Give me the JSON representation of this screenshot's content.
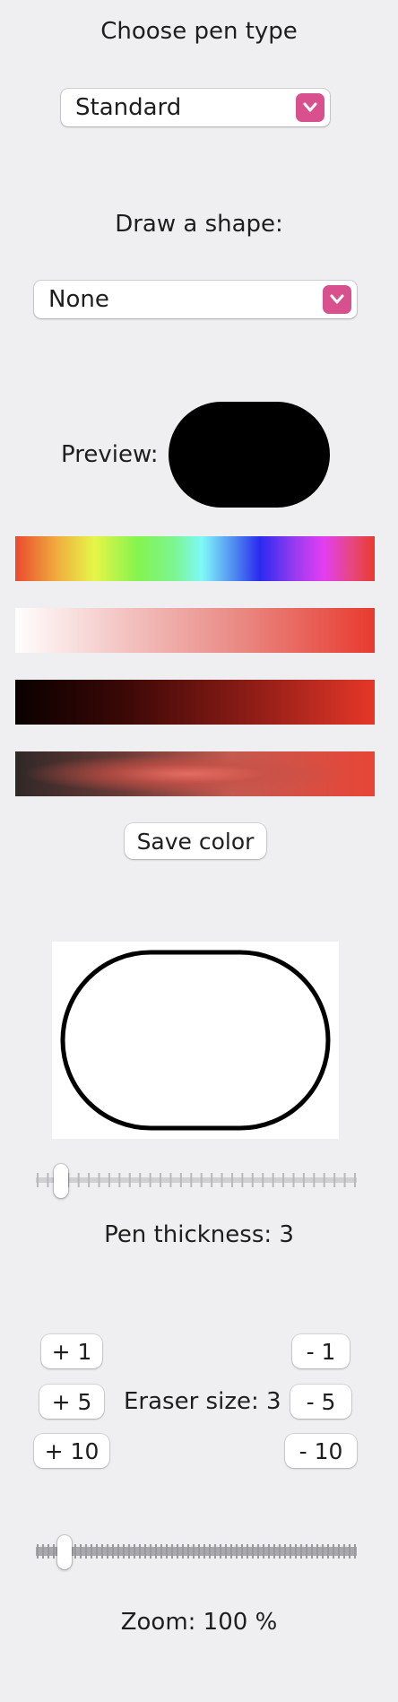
{
  "pen_type": {
    "title": "Choose pen type",
    "selected": "Standard"
  },
  "shape": {
    "title": "Draw a shape:",
    "selected": "None"
  },
  "preview": {
    "label": "Preview:",
    "color": "#000000"
  },
  "color_bars": [
    {
      "name": "hue",
      "icon": "hue-spectrum"
    },
    {
      "name": "saturation",
      "icon": "saturation-gradient"
    },
    {
      "name": "brightness",
      "icon": "brightness-gradient"
    },
    {
      "name": "opacity",
      "icon": "opacity-gradient"
    }
  ],
  "save_color": "Save color",
  "pen_thickness": {
    "label": "Pen thickness: 3",
    "value": 3
  },
  "eraser": {
    "label": "Eraser size: 3",
    "buttons": {
      "plus_1": "+ 1",
      "plus_5": "+ 5",
      "plus_10": "+ 10",
      "minus_1": "- 1",
      "minus_5": "- 5",
      "minus_10": "- 10"
    }
  },
  "zoom": {
    "label": "Zoom: 100 %",
    "value": 100
  },
  "colors": {
    "accent": "#d8508d",
    "background": "#efeff2",
    "shape_stroke": "#000000"
  }
}
